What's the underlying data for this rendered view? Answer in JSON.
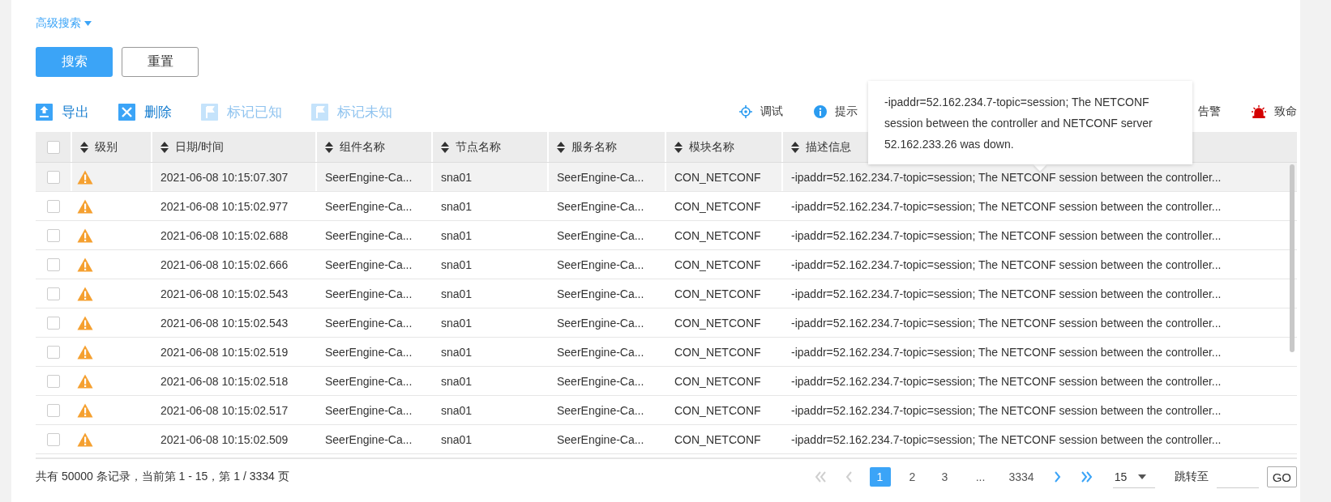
{
  "advanced_search": {
    "label": "高级搜索"
  },
  "search_buttons": [
    {
      "label": "搜索",
      "kind": "primary"
    },
    {
      "label": "重置",
      "kind": "default"
    }
  ],
  "actions": [
    {
      "label": "导出",
      "kind": "export",
      "disabled": false
    },
    {
      "label": "删除",
      "kind": "delete",
      "disabled": false
    },
    {
      "label": "标记已知",
      "kind": "flag",
      "disabled": true
    },
    {
      "label": "标记未知",
      "kind": "flag",
      "disabled": true
    }
  ],
  "legend": [
    {
      "label": "调试",
      "kind": "debug"
    },
    {
      "label": "提示",
      "kind": "info"
    },
    {
      "label": "告警",
      "kind": "plain"
    },
    {
      "label": "致命",
      "kind": "fatal"
    }
  ],
  "tooltip": {
    "text": "-ipaddr=52.162.234.7-topic=session; The NETCONF session between the controller and NETCONF server 52.162.233.26 was down."
  },
  "table": {
    "select_all": {
      "checked": false
    },
    "columns": [
      "",
      "级别",
      "日期/时间",
      "组件名称",
      "节点名称",
      "服务名称",
      "模块名称",
      "描述信息"
    ],
    "rows": [
      {
        "checked": false,
        "highlighted": true,
        "kind": "warning",
        "cells": [
          "",
          "",
          "2021-06-08 10:15:07.307",
          "SeerEngine-Ca...",
          "sna01",
          "SeerEngine-Ca...",
          "CON_NETCONF",
          "-ipaddr=52.162.234.7-topic=session; The NETCONF session between the controller..."
        ]
      },
      {
        "checked": false,
        "highlighted": false,
        "kind": "warning",
        "cells": [
          "",
          "",
          "2021-06-08 10:15:02.977",
          "SeerEngine-Ca...",
          "sna01",
          "SeerEngine-Ca...",
          "CON_NETCONF",
          "-ipaddr=52.162.234.7-topic=session; The NETCONF session between the controller..."
        ]
      },
      {
        "checked": false,
        "highlighted": false,
        "kind": "warning",
        "cells": [
          "",
          "",
          "2021-06-08 10:15:02.688",
          "SeerEngine-Ca...",
          "sna01",
          "SeerEngine-Ca...",
          "CON_NETCONF",
          "-ipaddr=52.162.234.7-topic=session; The NETCONF session between the controller..."
        ]
      },
      {
        "checked": false,
        "highlighted": false,
        "kind": "warning",
        "cells": [
          "",
          "",
          "2021-06-08 10:15:02.666",
          "SeerEngine-Ca...",
          "sna01",
          "SeerEngine-Ca...",
          "CON_NETCONF",
          "-ipaddr=52.162.234.7-topic=session; The NETCONF session between the controller..."
        ]
      },
      {
        "checked": false,
        "highlighted": false,
        "kind": "warning",
        "cells": [
          "",
          "",
          "2021-06-08 10:15:02.543",
          "SeerEngine-Ca...",
          "sna01",
          "SeerEngine-Ca...",
          "CON_NETCONF",
          "-ipaddr=52.162.234.7-topic=session; The NETCONF session between the controller..."
        ]
      },
      {
        "checked": false,
        "highlighted": false,
        "kind": "warning",
        "cells": [
          "",
          "",
          "2021-06-08 10:15:02.543",
          "SeerEngine-Ca...",
          "sna01",
          "SeerEngine-Ca...",
          "CON_NETCONF",
          "-ipaddr=52.162.234.7-topic=session; The NETCONF session between the controller..."
        ]
      },
      {
        "checked": false,
        "highlighted": false,
        "kind": "warning",
        "cells": [
          "",
          "",
          "2021-06-08 10:15:02.519",
          "SeerEngine-Ca...",
          "sna01",
          "SeerEngine-Ca...",
          "CON_NETCONF",
          "-ipaddr=52.162.234.7-topic=session; The NETCONF session between the controller..."
        ]
      },
      {
        "checked": false,
        "highlighted": false,
        "kind": "warning",
        "cells": [
          "",
          "",
          "2021-06-08 10:15:02.518",
          "SeerEngine-Ca...",
          "sna01",
          "SeerEngine-Ca...",
          "CON_NETCONF",
          "-ipaddr=52.162.234.7-topic=session; The NETCONF session between the controller..."
        ]
      },
      {
        "checked": false,
        "highlighted": false,
        "kind": "warning",
        "cells": [
          "",
          "",
          "2021-06-08 10:15:02.517",
          "SeerEngine-Ca...",
          "sna01",
          "SeerEngine-Ca...",
          "CON_NETCONF",
          "-ipaddr=52.162.234.7-topic=session; The NETCONF session between the controller..."
        ]
      },
      {
        "checked": false,
        "highlighted": false,
        "kind": "warning",
        "cells": [
          "",
          "",
          "2021-06-08 10:15:02.509",
          "SeerEngine-Ca...",
          "sna01",
          "SeerEngine-Ca...",
          "CON_NETCONF",
          "-ipaddr=52.162.234.7-topic=session; The NETCONF session between the controller..."
        ]
      }
    ]
  },
  "footer": {
    "summary": "共有 50000 条记录，当前第 1 - 15，第 1 / 3334 页",
    "pager": {
      "first": {
        "disabled": true
      },
      "prev": {
        "disabled": true
      },
      "pages": [
        {
          "label": "1",
          "kind": "page",
          "selected": true
        },
        {
          "label": "2",
          "kind": "page",
          "selected": false
        },
        {
          "label": "3",
          "kind": "page",
          "selected": false
        },
        {
          "label": "...",
          "kind": "ellipsis"
        },
        {
          "label": "3334",
          "kind": "page",
          "selected": false
        }
      ],
      "next": {
        "disabled": false
      },
      "last": {
        "disabled": false
      }
    },
    "page_size": "15",
    "jump_label": "跳转至",
    "go": "GO"
  }
}
